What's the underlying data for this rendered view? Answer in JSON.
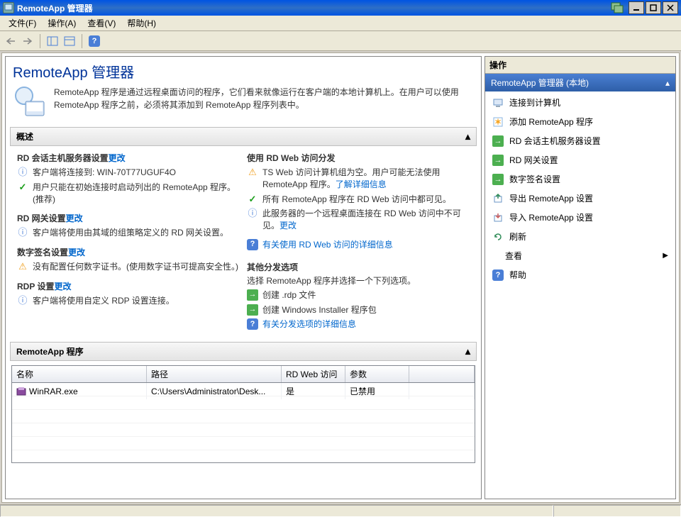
{
  "window": {
    "title": "RemoteApp 管理器"
  },
  "menu": {
    "file": "文件(F)",
    "action": "操作(A)",
    "view": "查看(V)",
    "help": "帮助(H)"
  },
  "left": {
    "title": "RemoteApp 管理器",
    "intro": "RemoteApp 程序是通过远程桌面访问的程序，它们看来就像运行在客户端的本地计算机上。在用户可以使用 RemoteApp 程序之前，必须将其添加到 RemoteApp 程序列表中。",
    "overview_header": "概述",
    "col1": {
      "t1": "RD 会话主机服务器设置",
      "t1_link": "更改",
      "l1": "客户端将连接到: WIN-70T77UGUF4O",
      "l2": "用户只能在初始连接时启动列出的 RemoteApp 程序。(推荐)",
      "t2": "RD 网关设置",
      "t2_link": "更改",
      "l3": "客户端将使用由其域的组策略定义的 RD 网关设置。",
      "t3": "数字签名设置",
      "t3_link": "更改",
      "l4": "没有配置任何数字证书。(使用数字证书可提高安全性。)",
      "t4": "RDP 设置",
      "t4_link": "更改",
      "l5": "客户端将使用自定义 RDP 设置连接。"
    },
    "col2": {
      "t1": "使用 RD Web 访问分发",
      "l1a": "TS Web 访问计算机组为空。用户可能无法使用 RemoteApp 程序。",
      "l1b": "了解详细信息",
      "l2": "所有 RemoteApp 程序在 RD Web 访问中都可见。",
      "l3a": "此服务器的一个远程桌面连接在 RD Web 访问中不可见。",
      "l3b": "更改",
      "link1": "有关使用 RD Web 访问的详细信息",
      "t2": "其他分发选项",
      "sub2": "选择 RemoteApp 程序并选择一个下列选项。",
      "opt1": "创建 .rdp 文件",
      "opt2": "创建 Windows Installer 程序包",
      "link2": "有关分发选项的详细信息"
    },
    "programs_header": "RemoteApp 程序",
    "grid": {
      "h1": "名称",
      "h2": "路径",
      "h3": "RD Web 访问",
      "h4": "参数",
      "row": {
        "name": "WinRAR.exe",
        "path": "C:\\Users\\Administrator\\Desk...",
        "web": "是",
        "args": "已禁用"
      }
    }
  },
  "right": {
    "header": "操作",
    "band": "RemoteApp 管理器 (本地)",
    "items": {
      "connect": "连接到计算机",
      "add": "添加 RemoteApp 程序",
      "rdhost": "RD 会话主机服务器设置",
      "rdgw": "RD 网关设置",
      "sign": "数字签名设置",
      "export": "导出 RemoteApp 设置",
      "import": "导入 RemoteApp 设置",
      "refresh": "刷新",
      "view": "查看",
      "help": "帮助"
    }
  }
}
